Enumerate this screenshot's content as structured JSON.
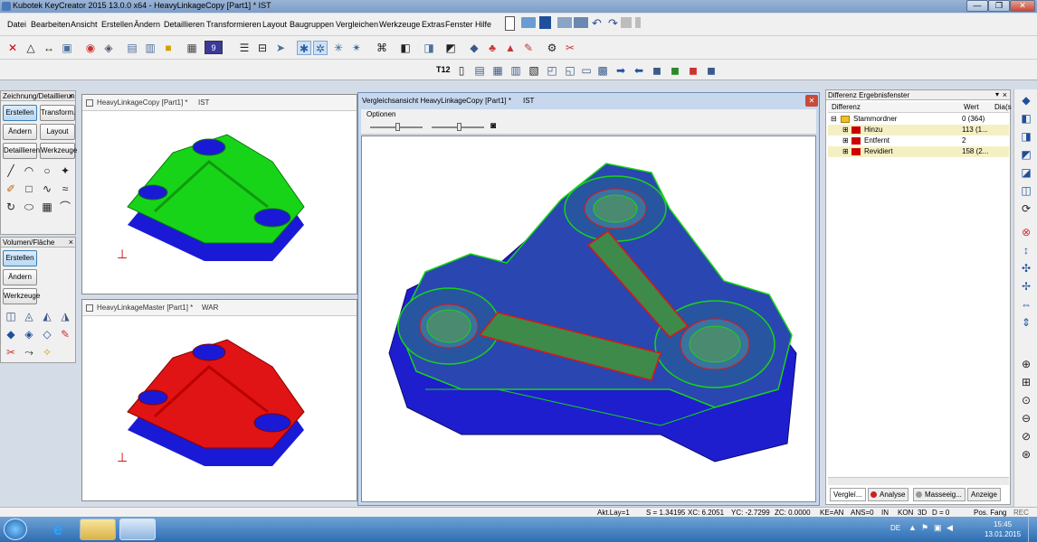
{
  "window": {
    "title": "Kubotek KeyCreator 2015 13.0.0 x64 - HeavyLinkageCopy [Part1] *    IST",
    "minimize": "—",
    "restore": "❐",
    "close": "✕"
  },
  "menu": [
    "Datei",
    "Bearbeiten",
    "Ansicht",
    "Erstellen",
    "Ändern",
    "Detaillieren",
    "Transformieren",
    "Layout",
    "Baugruppen",
    "Vergleichen",
    "Werkzeuge",
    "Extras",
    "Fenster",
    "Hilfe"
  ],
  "toolbar2": {
    "t12_label": "T12",
    "layer_box": "9"
  },
  "left_panel1": {
    "title": "Zeichnung/Detaillierun",
    "close": "×",
    "buttons": [
      "Erstellen",
      "Transform.",
      "Ändern",
      "Layout",
      "Detaillieren",
      "Werkzeuge"
    ]
  },
  "left_panel2": {
    "title": "Volumen/Fläche",
    "close": "×",
    "buttons": [
      "Erstellen",
      "Ändern",
      "Werkzeuge"
    ]
  },
  "viewport_top": {
    "title": "HeavyLinkageCopy [Part1] *",
    "tag": "IST"
  },
  "viewport_bottom": {
    "title": "HeavyLinkageMaster [Part1] *",
    "tag": "WAR"
  },
  "compare_window": {
    "title": "Vergleichsansicht HeavyLinkageCopy [Part1] *",
    "tag": "IST",
    "close": "✕",
    "menu": "Optionen"
  },
  "diff_panel": {
    "title": "Differenz Ergebnisfenster",
    "pin": "▾",
    "close": "×",
    "columns": [
      "Differenz",
      "Wert",
      "Dia(s"
    ],
    "rows": [
      {
        "name": "Stammordner",
        "value": "0 (364)",
        "toggle": "⊟",
        "highlight": false,
        "color": "#f0c020"
      },
      {
        "name": "Hinzu",
        "value": "113 (1...",
        "toggle": "⊞",
        "highlight": true,
        "color": "#cc0000"
      },
      {
        "name": "Entfernt",
        "value": "2",
        "toggle": "⊞",
        "highlight": false,
        "color": "#cc0000"
      },
      {
        "name": "Revidiert",
        "value": "158 (2...",
        "toggle": "⊞",
        "highlight": true,
        "color": "#cc0000"
      }
    ],
    "tabs": [
      "Vergleí...",
      "Analyse",
      "Masseeig...",
      "Anzeige"
    ]
  },
  "statusbar": {
    "layer": "Akt.Lay=1",
    "s": "S = 1.34195",
    "xc": "XC: 6.2051",
    "yc": "YC: -2.7299",
    "zc": "ZC: 0.0000",
    "ke": "KE=AN",
    "ans": "ANS=0",
    "units": "IN",
    "kon": "KON",
    "mode": "3D",
    "d": "D = 0",
    "pos": "Pos. Fang",
    "rec": "REC"
  },
  "taskbar": {
    "lang": "DE",
    "time": "15:45",
    "date": "13.01.2015"
  },
  "colors": {
    "copy_model": "#18d418",
    "master_model": "#e01414",
    "base": "#1a1ad6",
    "diff_highlight": "#f5f0c4"
  }
}
